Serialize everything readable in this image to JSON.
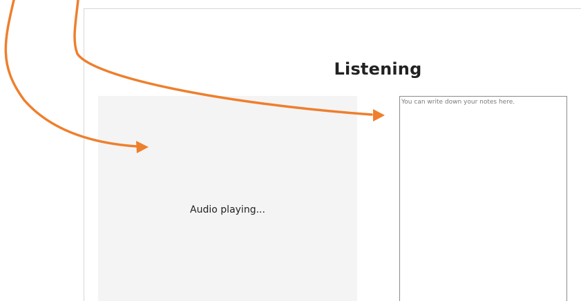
{
  "page": {
    "title": "Listening"
  },
  "audio": {
    "status": "Audio playing..."
  },
  "notes": {
    "placeholder": "You can write down your notes here.",
    "value": ""
  },
  "annotations": {
    "arrow_color": "#ee7f2d",
    "arrows": [
      "arrow-to-audio-panel",
      "arrow-to-notes-field"
    ]
  },
  "colors": {
    "panel_background": "#f4f4f4",
    "frame_border": "#d6d6d6",
    "text": "#222222"
  }
}
